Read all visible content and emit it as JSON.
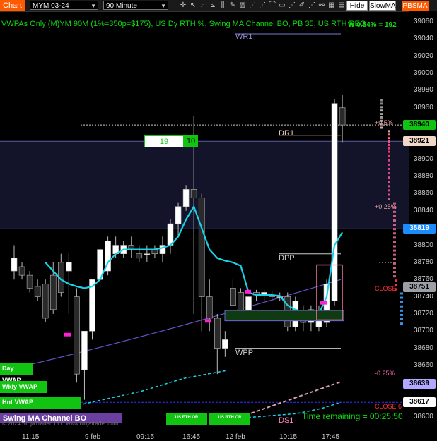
{
  "toolbar": {
    "chart_tab": "Chart",
    "instrument": "MYM 03-24",
    "interval": "90 Minute",
    "hide_label": "Hide",
    "slowma_label": "SlowMA",
    "pbsma_label": "PBSMA",
    "tool_icons": [
      "crosshair-icon",
      "cursor-icon",
      "zoom-icon",
      "ruler-icon",
      "bar-chart-icon",
      "pencil-icon",
      "hatched-icon",
      "dots-icon",
      "dots-icon",
      "wifi-icon",
      "rect-icon",
      "dots-icon",
      "brush-icon",
      "dots-icon",
      "link-icon",
      "calendar-icon",
      "grid-icon"
    ]
  },
  "header": {
    "indicator_text": "VWPAs Only (M)YM 90M (1%=350p=$175), US Dy RTH %, Swing MA Channel BO, PB 35, US RTH REG",
    "w_pct": "W 0.54% = 192"
  },
  "levels": {
    "wr1": "WR1",
    "dr1": "DR1",
    "dpp": "DPP",
    "wpp": "WPP",
    "ds1": "DS1",
    "plus_05": "+0.5%",
    "plus_025": "+0.25%",
    "minus_025": "-0.25%",
    "close": "CLOSE",
    "close6": "CLOSE 6"
  },
  "counter": {
    "left": "19",
    "right": "10"
  },
  "vwap_buttons": [
    "Day VWAP",
    "Wkly VWAP",
    "Hnt VWAP"
  ],
  "rth_buttons": [
    "US ETH OR",
    "US RTH OR"
  ],
  "strategy_label": "Swing MA Channel BO",
  "copyright_text": "© 2024 NinjaTrader, LLC  www.ninjatrader.com",
  "time_remaining": "Time remaining = 00:25:50",
  "y_axis": {
    "ticks": [
      "39060",
      "39040",
      "39020",
      "39000",
      "38980",
      "38960",
      "38940",
      "38920",
      "38900",
      "38880",
      "38860",
      "38840",
      "38820",
      "38800",
      "38780",
      "38760",
      "38740",
      "38720",
      "38700",
      "38680",
      "38660",
      "38640",
      "38620",
      "38600"
    ],
    "tags": [
      {
        "value": "38940",
        "bg": "#11c411",
        "fg": "#000000"
      },
      {
        "value": "38921",
        "bg": "#f0d8c8",
        "fg": "#000000"
      },
      {
        "value": "38819",
        "bg": "#1a8cff",
        "fg": "#ffffff"
      },
      {
        "value": "38751",
        "bg": "#9aa0a6",
        "fg": "#000000"
      },
      {
        "value": "38639",
        "bg": "#b0a8ff",
        "fg": "#000000"
      },
      {
        "value": "38617",
        "bg": "#ffffff",
        "fg": "#000000"
      }
    ]
  },
  "x_axis": [
    "11:15",
    "9 feb",
    "09:15",
    "16:45",
    "12 feb",
    "10:15",
    "17:45"
  ],
  "colors": {
    "accent_orange": "#ff5a00",
    "green": "#11c411",
    "cyan": "#19d3e8",
    "purple_band": "#13132a",
    "up_candle": "#ffffff",
    "down_candle": "#2a2a2a"
  },
  "chart_data": {
    "type": "candlestick",
    "ylim": [
      38595,
      39065
    ],
    "candles": [
      {
        "o": 38770,
        "h": 38800,
        "l": 38760,
        "c": 38785
      },
      {
        "o": 38775,
        "h": 38780,
        "l": 38760,
        "c": 38765
      },
      {
        "o": 38765,
        "h": 38770,
        "l": 38745,
        "c": 38750
      },
      {
        "o": 38752,
        "h": 38760,
        "l": 38735,
        "c": 38740
      },
      {
        "o": 38755,
        "h": 38760,
        "l": 38710,
        "c": 38715
      },
      {
        "o": 38765,
        "h": 38780,
        "l": 38720,
        "c": 38725
      },
      {
        "o": 38780,
        "h": 38790,
        "l": 38740,
        "c": 38745
      },
      {
        "o": 38770,
        "h": 38790,
        "l": 38720,
        "c": 38780
      },
      {
        "o": 38740,
        "h": 38750,
        "l": 38640,
        "c": 38650
      },
      {
        "o": 38655,
        "h": 38700,
        "l": 38620,
        "c": 38700
      },
      {
        "o": 38700,
        "h": 38760,
        "l": 38690,
        "c": 38760
      },
      {
        "o": 38760,
        "h": 38800,
        "l": 38750,
        "c": 38795
      },
      {
        "o": 38770,
        "h": 38810,
        "l": 38765,
        "c": 38805
      },
      {
        "o": 38790,
        "h": 38810,
        "l": 38785,
        "c": 38800
      },
      {
        "o": 38790,
        "h": 38805,
        "l": 38785,
        "c": 38800
      },
      {
        "o": 38800,
        "h": 38810,
        "l": 38785,
        "c": 38795
      },
      {
        "o": 38790,
        "h": 38800,
        "l": 38780,
        "c": 38785
      },
      {
        "o": 38790,
        "h": 38800,
        "l": 38780,
        "c": 38790
      },
      {
        "o": 38795,
        "h": 38800,
        "l": 38785,
        "c": 38790
      },
      {
        "o": 38790,
        "h": 38810,
        "l": 38780,
        "c": 38800
      },
      {
        "o": 38800,
        "h": 38830,
        "l": 38790,
        "c": 38825
      },
      {
        "o": 38825,
        "h": 38850,
        "l": 38810,
        "c": 38845
      },
      {
        "o": 38845,
        "h": 38870,
        "l": 38840,
        "c": 38865
      },
      {
        "o": 38865,
        "h": 38950,
        "l": 38720,
        "c": 38855
      },
      {
        "o": 38855,
        "h": 38860,
        "l": 38700,
        "c": 38740
      },
      {
        "o": 38740,
        "h": 38760,
        "l": 38700,
        "c": 38715
      },
      {
        "o": 38715,
        "h": 38720,
        "l": 38650,
        "c": 38680
      },
      {
        "o": 38680,
        "h": 38700,
        "l": 38670,
        "c": 38690
      },
      {
        "o": 38750,
        "h": 38760,
        "l": 38730,
        "c": 38730
      },
      {
        "o": 38745,
        "h": 38750,
        "l": 38720,
        "c": 38722
      },
      {
        "o": 38722,
        "h": 38740,
        "l": 38715,
        "c": 38740
      },
      {
        "o": 38745,
        "h": 38748,
        "l": 38735,
        "c": 38742
      },
      {
        "o": 38742,
        "h": 38748,
        "l": 38735,
        "c": 38745
      },
      {
        "o": 38742,
        "h": 38746,
        "l": 38735,
        "c": 38740
      },
      {
        "o": 38740,
        "h": 38745,
        "l": 38735,
        "c": 38740
      },
      {
        "o": 38740,
        "h": 38745,
        "l": 38700,
        "c": 38705
      },
      {
        "o": 38705,
        "h": 38740,
        "l": 38700,
        "c": 38735
      },
      {
        "o": 38720,
        "h": 38730,
        "l": 38700,
        "c": 38710
      },
      {
        "o": 38710,
        "h": 38730,
        "l": 38700,
        "c": 38725
      },
      {
        "o": 38705,
        "h": 38730,
        "l": 38700,
        "c": 38715
      },
      {
        "o": 38710,
        "h": 38760,
        "l": 38705,
        "c": 38755
      },
      {
        "o": 38735,
        "h": 38970,
        "l": 38730,
        "c": 38965
      },
      {
        "o": 38960,
        "h": 38975,
        "l": 38920,
        "c": 38940
      }
    ],
    "ma_cyan": [
      null,
      null,
      null,
      null,
      38780,
      38770,
      38760,
      38755,
      38752,
      38750,
      38752,
      38760,
      38780,
      38790,
      38795,
      38795,
      38795,
      38795,
      38795,
      38797,
      38800,
      38810,
      38830,
      38845,
      38820,
      38795,
      38785,
      38782,
      38780,
      38776,
      38745,
      38742,
      38742,
      38742,
      38741,
      38730,
      38725,
      38722,
      38720,
      38720,
      38740,
      38800,
      38815
    ],
    "horizontal_levels": [
      {
        "name": "WR1",
        "value": 39046
      },
      {
        "name": "DR1",
        "value": 38936
      },
      {
        "name": "DPP",
        "value": 38790
      },
      {
        "name": "WPP",
        "value": 38680
      }
    ]
  }
}
